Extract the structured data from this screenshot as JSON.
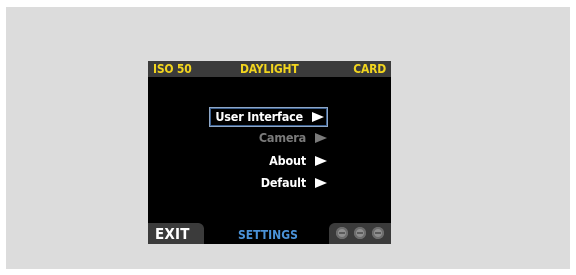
{
  "status_bar": {
    "iso": "ISO 50",
    "white_balance": "DAYLIGHT",
    "storage": "CARD"
  },
  "menu": {
    "items": [
      {
        "label": "User Interface",
        "enabled": true,
        "selected": true
      },
      {
        "label": "Camera",
        "enabled": false,
        "selected": false
      },
      {
        "label": "About",
        "enabled": true,
        "selected": false
      },
      {
        "label": "Default",
        "enabled": true,
        "selected": false
      }
    ]
  },
  "bottom_bar": {
    "exit_label": "EXIT",
    "section_label": "SETTINGS",
    "indicator_icon": "three-dots-icon"
  },
  "colors": {
    "status_text": "#f2d51e",
    "section_text": "#4a92d8",
    "disabled_text": "#7a7a7a",
    "selection_border": "#8fa8c8"
  }
}
